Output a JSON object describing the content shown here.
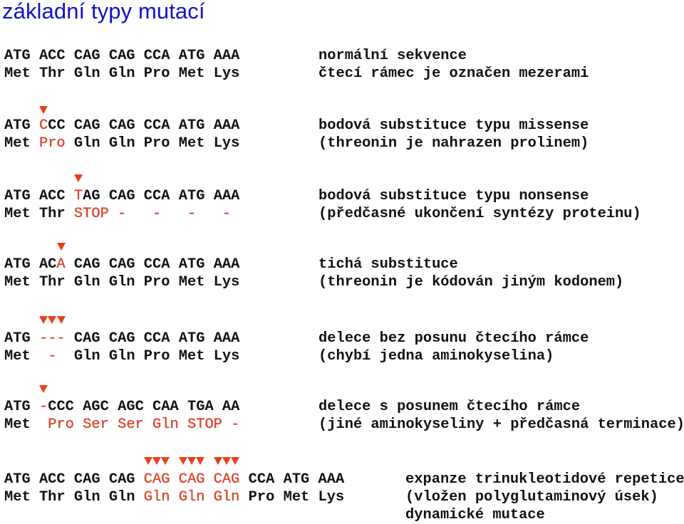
{
  "title": "základní typy mutací",
  "colors": {
    "title": "#1212c8",
    "mutation": "#dc4428",
    "marker": "#e8401c",
    "text": "#111111"
  },
  "marker_icon": "red-down-triangle",
  "blocks": [
    {
      "id": "normal",
      "markers": [],
      "dna": [
        {
          "t": "ATG ACC CAG CAG CCA ATG AAA",
          "red": false
        }
      ],
      "protein": [
        {
          "t": "Met Thr Gln Gln Pro Met Lys",
          "red": false
        }
      ],
      "desc": [
        "normální sekvence",
        "čtecí rámec je označen mezerami"
      ]
    },
    {
      "id": "missense",
      "markers": [
        4
      ],
      "dna": [
        {
          "t": "ATG ",
          "red": false
        },
        {
          "t": "C",
          "red": true
        },
        {
          "t": "CC CAG CAG CCA ATG AAA",
          "red": false
        }
      ],
      "protein": [
        {
          "t": "Met ",
          "red": false
        },
        {
          "t": "Pro",
          "red": true
        },
        {
          "t": " Gln Gln Pro Met Lys",
          "red": false
        }
      ],
      "desc": [
        "bodová substituce typu missense",
        "(threonin je nahrazen prolinem)"
      ]
    },
    {
      "id": "nonsense",
      "markers": [
        8
      ],
      "dna": [
        {
          "t": "ATG ACC ",
          "red": false
        },
        {
          "t": "T",
          "red": true
        },
        {
          "t": "AG CAG CCA ATG AAA",
          "red": false
        }
      ],
      "protein": [
        {
          "t": "Met Thr ",
          "red": false
        },
        {
          "t": "STOP -   -   -   -",
          "red": true
        }
      ],
      "desc": [
        "bodová substituce typu nonsense",
        "(předčasné ukončení syntézy proteinu)"
      ]
    },
    {
      "id": "silent",
      "markers": [
        6
      ],
      "dna": [
        {
          "t": "ATG AC",
          "red": false
        },
        {
          "t": "A",
          "red": true
        },
        {
          "t": " CAG CAG CCA ATG AAA",
          "red": false
        }
      ],
      "protein": [
        {
          "t": "Met Thr Gln Gln Pro Met Lys",
          "red": false
        }
      ],
      "desc": [
        "tichá substituce",
        "(threonin je kódován jiným kodonem)"
      ]
    },
    {
      "id": "inframe-deletion",
      "markers": [
        4,
        5,
        6
      ],
      "dna": [
        {
          "t": "ATG ",
          "red": false
        },
        {
          "t": "---",
          "red": true
        },
        {
          "t": " CAG CAG CCA ATG AAA",
          "red": false
        }
      ],
      "protein": [
        {
          "t": "Met ",
          "red": false
        },
        {
          "t": " - ",
          "red": true
        },
        {
          "t": " Gln Gln Pro Met Lys",
          "red": false
        }
      ],
      "desc": [
        "delece bez posunu čtecího rámce",
        "(chybí jedna aminokyselina)"
      ]
    },
    {
      "id": "frameshift-deletion",
      "markers": [
        4
      ],
      "dna": [
        {
          "t": "ATG ",
          "red": false
        },
        {
          "t": "-",
          "red": true
        },
        {
          "t": "CCC AGC AGC CAA TGA AA",
          "red": false
        }
      ],
      "protein": [
        {
          "t": "Met  ",
          "red": false
        },
        {
          "t": "Pro Ser Ser Gln STOP -",
          "red": true
        }
      ],
      "desc": [
        "delece s posunem čtecího rámce",
        "(jiné aminokyseliny + předčasná terminace)"
      ]
    },
    {
      "id": "trinucleotide-expansion",
      "markers": [
        16,
        17,
        18,
        20,
        21,
        22,
        24,
        25,
        26
      ],
      "dna": [
        {
          "t": "ATG ACC CAG CAG ",
          "red": false
        },
        {
          "t": "CAG CAG CAG",
          "red": true
        },
        {
          "t": " CCA ATG AAA",
          "red": false
        }
      ],
      "protein": [
        {
          "t": "Met Thr Gln Gln ",
          "red": false
        },
        {
          "t": "Gln Gln Gln",
          "red": true
        },
        {
          "t": " Pro Met Lys",
          "red": false
        }
      ],
      "desc": [
        "expanze trinukleotidové repetice",
        "(vložen polyglutaminový úsek)",
        "dynamické mutace"
      ]
    }
  ]
}
